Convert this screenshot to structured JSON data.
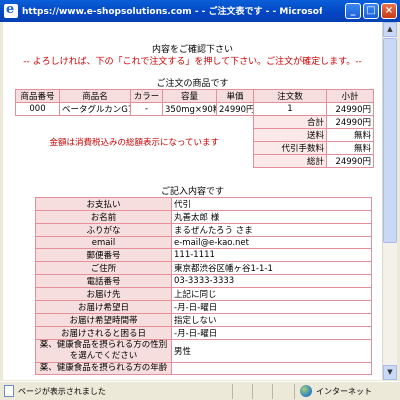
{
  "window": {
    "title": "https://www.e-shopsolutions.com - - ご注文表です - - Microsoft Internet E...",
    "min_label": "_",
    "max_label": "□",
    "close_label": "×"
  },
  "page": {
    "confirm_title": "内容をご確認下さい",
    "confirm_note": "-- よろしければ、下の「これで注文する」を押して下さい。ご注文が確定します。--",
    "order_section_title": "ご注文の商品です",
    "order_table": {
      "headers": [
        "商品番号",
        "商品名",
        "カラー",
        "容量",
        "単価",
        "注文数",
        "小計"
      ],
      "row": [
        "000",
        "ベータグルカンG7",
        "-",
        "350mg×90粒",
        "24990円",
        "1",
        "24990円"
      ],
      "tax_note": "金額は消費税込みの総額表示になっています",
      "summary": [
        {
          "label": "合計",
          "value": "24990円"
        },
        {
          "label": "送料",
          "value": "無料"
        },
        {
          "label": "代引手数料",
          "value": "無料"
        },
        {
          "label": "総計",
          "value": "24990円"
        }
      ]
    },
    "entry_section_title": "ご記入内容です",
    "entry_table": [
      {
        "label": "お支払い",
        "value": "代引"
      },
      {
        "label": "お名前",
        "value": "丸善太郎 様"
      },
      {
        "label": "ふりがな",
        "value": "まるぜんたろう さま"
      },
      {
        "label": "email",
        "value": "e-mail@e-kao.net"
      },
      {
        "label": "郵便番号",
        "value": "111-1111"
      },
      {
        "label": "ご住所",
        "value": "東京都渋谷区幡ヶ谷1-1-1"
      },
      {
        "label": "電話番号",
        "value": "03-3333-3333"
      },
      {
        "label": "お届け先",
        "value": "上記に同じ"
      },
      {
        "label": "お届け希望日",
        "value": "-月-日-曜日"
      },
      {
        "label": "お届け希望時間帯",
        "value": "指定しない"
      },
      {
        "label": "お届けされると困る日",
        "value": "-月-日-曜日"
      },
      {
        "label": "薬、健康食品を摂られる方の性別を選んでください",
        "value": "男性"
      },
      {
        "label": "薬、健康食品を摂られる方の年齢",
        "value": ""
      }
    ]
  },
  "statusbar": {
    "text": "ページが表示されました",
    "zone": "インターネット"
  }
}
